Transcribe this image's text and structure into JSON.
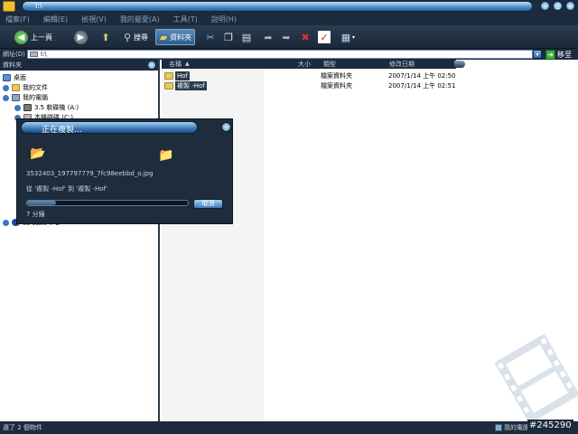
{
  "window": {
    "title": "I:\\"
  },
  "menu": [
    "檔案(F)",
    "編輯(E)",
    "檢視(V)",
    "我的最愛(A)",
    "工具(T)",
    "說明(H)"
  ],
  "toolbar": {
    "back": "上一頁",
    "search": "搜尋",
    "folders": "資料夾"
  },
  "address": {
    "label": "網址(D)",
    "value": "I:\\",
    "go": "移至"
  },
  "folders_pane": {
    "title": "資料夾",
    "items": [
      "桌面",
      "我的文件",
      "我的電腦",
      "3.5 軟碟機 (A:)",
      "本機磁碟 (C:)",
      "我的藍芽中心"
    ]
  },
  "files": {
    "columns": {
      "name": "名稱",
      "size": "大小",
      "type": "類型",
      "date": "修改日期"
    },
    "rows": [
      {
        "name": "Hof",
        "type": "檔案資料夾",
        "date": "2007/1/14 上午 02:50"
      },
      {
        "name": "複製 -Hof",
        "type": "檔案資料夾",
        "date": "2007/1/14 上午 02:51"
      }
    ]
  },
  "dialog": {
    "title": "正在複製...",
    "filename": "3532403_197797779_7fc98eebbd_o.jpg",
    "from_to": "從 '複製 -Hof' 到 '複製 -Hof'",
    "remaining": "7 分鐘",
    "cancel": "取消",
    "progress": 0.18
  },
  "status": {
    "left": "選了 2 個物件",
    "right": "我的電腦",
    "badge": "#245290"
  },
  "colors": {
    "chrome": "#1b2a3c",
    "accent": "#3a7ab8"
  }
}
